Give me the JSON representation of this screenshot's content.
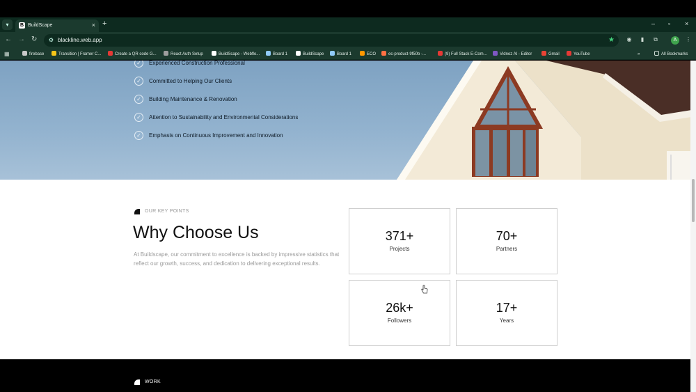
{
  "browser": {
    "tab": {
      "title": "BuildScape",
      "favicon_letter": "B",
      "close": "×"
    },
    "new_tab": "+",
    "window_controls": [
      "–",
      "▫",
      "×"
    ],
    "url": "blackline.web.app",
    "profile_initial": "A",
    "bookmarks": [
      {
        "label": "firebase",
        "color": "#c8c8c8"
      },
      {
        "label": "Transition | Framer C...",
        "color": "#f5c518"
      },
      {
        "label": "Create a QR code G...",
        "color": "#e53935"
      },
      {
        "label": "React Auth Setup",
        "color": "#9e9e9e"
      },
      {
        "label": "BuildScape - Webflo...",
        "color": "#ffffff"
      },
      {
        "label": "Board 1",
        "color": "#90caf9"
      },
      {
        "label": "BuildScape",
        "color": "#ffffff"
      },
      {
        "label": "Board 1",
        "color": "#90caf9"
      },
      {
        "label": "ECO",
        "color": "#ff9800"
      },
      {
        "label": "ec-product-9f50b -...",
        "color": "#ff7043"
      },
      {
        "label": "(9) Full Stack E-Com...",
        "color": "#e53935"
      },
      {
        "label": "Vidnoz AI - Editor",
        "color": "#7e57c2"
      },
      {
        "label": "Gmail",
        "color": "#ea4335"
      },
      {
        "label": "YouTube",
        "color": "#e53935"
      }
    ],
    "more_bookmarks": "»",
    "all_bookmarks": "All Bookmarks"
  },
  "hero": {
    "items": [
      "Experienced Construction Professional",
      "Committed to Helping Our Clients",
      "Building Maintenance & Renovation",
      "Attention to Sustainability and Environmental Considerations",
      "Emphasis on Continuous Improvement and Innovation"
    ]
  },
  "key_points": {
    "eyebrow": "OUR KEY POINTS",
    "title": "Why Choose Us",
    "description": "At Buildscape, our commitment to excellence is backed by impressive statistics that reflect our growth, success, and dedication to delivering exceptional results.",
    "stats": [
      {
        "value": "371+",
        "label": "Projects"
      },
      {
        "value": "70+",
        "label": "Partners"
      },
      {
        "value": "26k+",
        "label": "Followers"
      },
      {
        "value": "17+",
        "label": "Years"
      }
    ]
  },
  "work": {
    "label": "WORK"
  }
}
